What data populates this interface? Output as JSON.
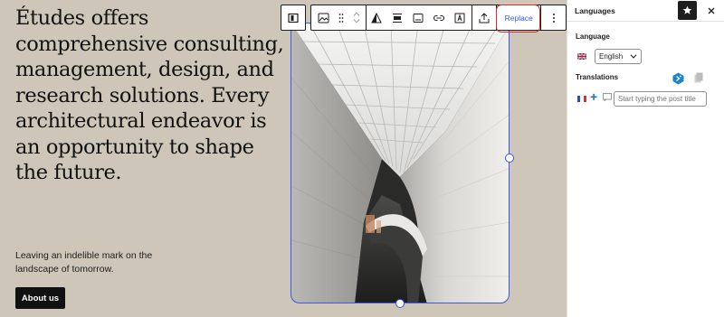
{
  "canvas": {
    "heading": "Études offers comprehensive consulting, management, design, and research solutions. Every architectural endeavor is an opportunity to shape the future.",
    "subtext": "Leaving an indelible mark on the landscape of tomorrow.",
    "button_label": "About us",
    "background_color": "#cdc6b9"
  },
  "toolbar": {
    "replace_label": "Replace",
    "icons": [
      "block-type-icon",
      "image-icon",
      "drag-handle-icon",
      "move-up-icon",
      "move-down-icon",
      "duotone-icon",
      "align-icon",
      "caption-icon",
      "link-icon",
      "text-overlay-icon",
      "upload-icon",
      "more-options-icon"
    ]
  },
  "sidebar": {
    "title": "Languages",
    "language_label": "Language",
    "language_selected": "English",
    "translations_label": "Translations",
    "translation_placeholder": "Start typing the post title"
  },
  "colors": {
    "accent": "#3858e9",
    "highlight": "#d92e2e",
    "dark": "#1e1e1e"
  }
}
